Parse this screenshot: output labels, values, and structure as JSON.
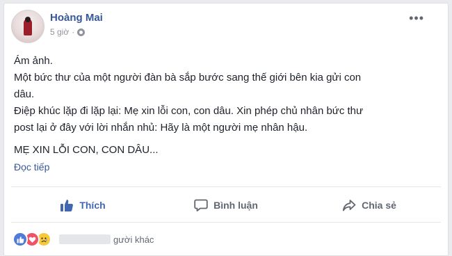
{
  "post": {
    "author": "Hoàng Mai",
    "time": "5 giờ",
    "more_icon": "more-icon",
    "lines": [
      "Ám ảnh.",
      "Một bức thư của một người đàn bà sắp bước sang thế giới bên kia gửi con",
      "dâu.",
      "Điệp khúc lặp đi lặp lại: Mẹ xin lỗi con, con dâu. Xin phép chủ nhân bức thư",
      "post lại ở đây với lời nhắn nhủ: Hãy là một người mẹ nhân hậu."
    ],
    "caps_line": "MẸ XIN LỖI CON, CON DÂU...",
    "read_more": "Đọc tiếp"
  },
  "actions": {
    "like": "Thích",
    "comment": "Bình luận",
    "share": "Chia sẻ"
  },
  "reactions": {
    "icons": [
      "like-icon",
      "love-icon",
      "sad-icon"
    ],
    "others_label": "gười khác"
  },
  "colors": {
    "link": "#365899",
    "like_active": "#4267b2",
    "muted": "#90949c"
  }
}
